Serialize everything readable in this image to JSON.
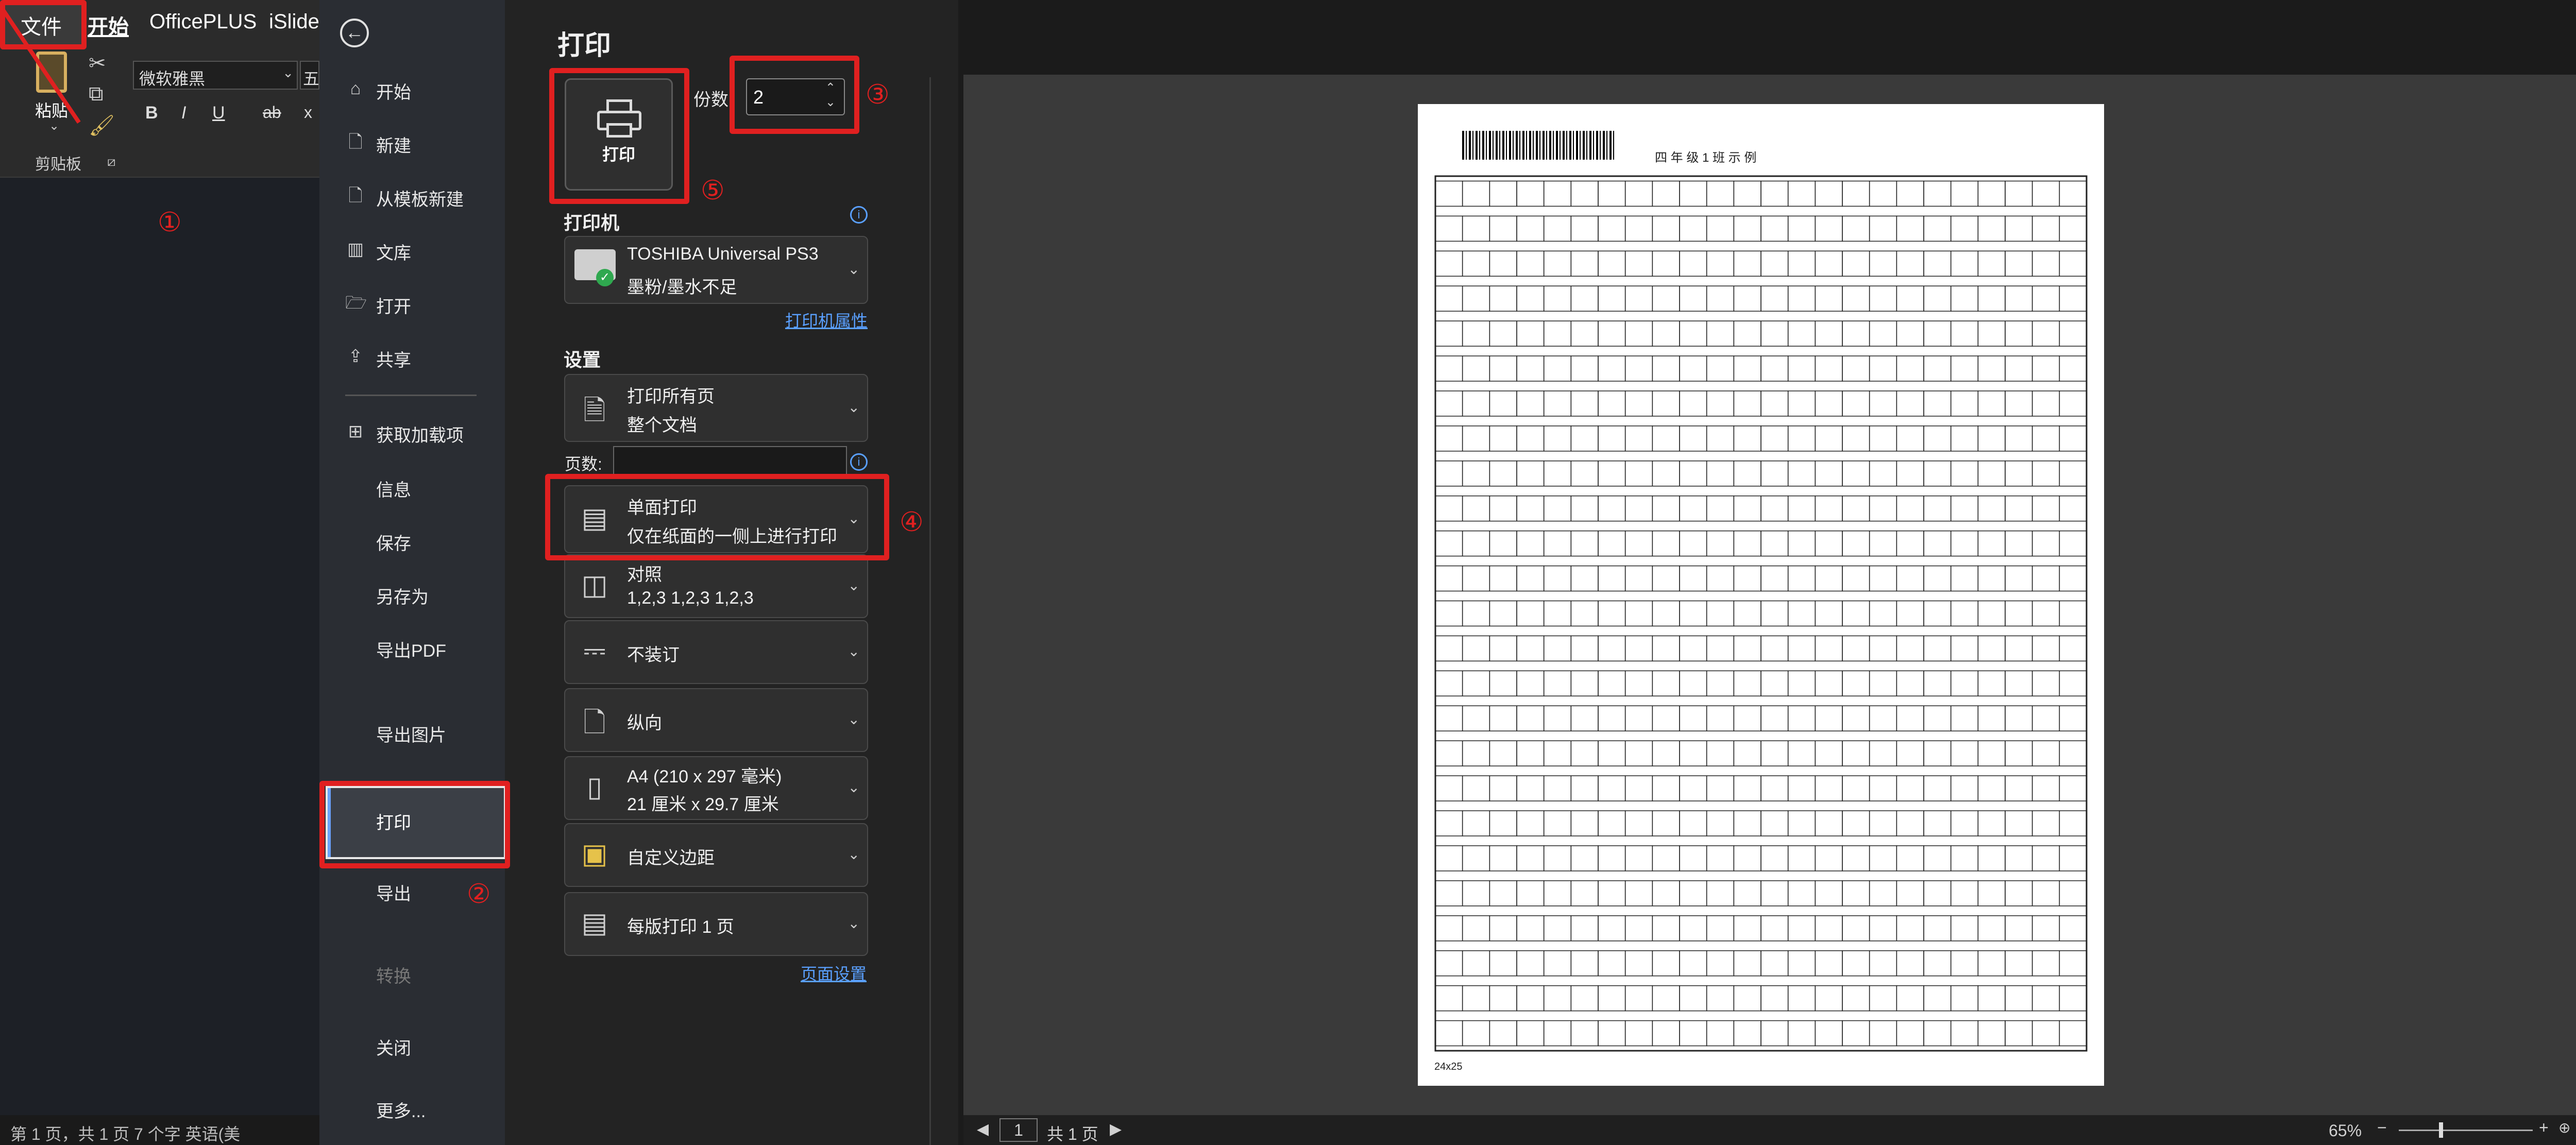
{
  "ribbon": {
    "tabs": [
      "文件",
      "开始",
      "OfficePLUS",
      "iSlide"
    ],
    "paste_label": "粘贴",
    "font_name": "微软雅黑",
    "font_size": "五",
    "clipboard_label": "剪贴板",
    "format_buttons": [
      "B",
      "I",
      "U",
      "ab",
      "x"
    ]
  },
  "status_left": "第 1 页，共 1 页    7 个字    英语(美",
  "nav": {
    "items": [
      "开始",
      "新建",
      "从模板新建",
      "文库",
      "打开",
      "共享",
      "获取加载项",
      "信息",
      "保存",
      "另存为",
      "导出PDF",
      "导出图片",
      "打印",
      "导出",
      "转换",
      "关闭",
      "更多..."
    ]
  },
  "print": {
    "title": "打印",
    "print_button": "打印",
    "copies_label": "份数",
    "copies_value": "2",
    "printer_heading": "打印机",
    "printer_name": "TOSHIBA Universal PS3",
    "printer_status": "墨粉/墨水不足",
    "printer_props_link": "打印机属性",
    "settings_heading": "设置",
    "pages_label": "页数:",
    "pages_value": "",
    "settings": [
      {
        "l1": "打印所有页",
        "l2": "整个文档",
        "icon": "document-icon"
      },
      {
        "l1": "单面打印",
        "l2": "仅在纸面的一侧上进行打印",
        "icon": "single-side-icon"
      },
      {
        "l1": "对照",
        "l2": "1,2,3    1,2,3    1,2,3",
        "icon": "collate-icon"
      },
      {
        "l1": "不装订",
        "l2": "",
        "icon": "staple-icon"
      },
      {
        "l1": "纵向",
        "l2": "",
        "icon": "portrait-icon"
      },
      {
        "l1": "A4 (210 x 297 毫米)",
        "l2": "21 厘米 x 29.7 厘米",
        "icon": "paper-size-icon"
      },
      {
        "l1": "自定义边距",
        "l2": "",
        "icon": "margins-icon"
      },
      {
        "l1": "每版打印 1 页",
        "l2": "",
        "icon": "pages-per-sheet-icon"
      }
    ],
    "page_setup_link": "页面设置"
  },
  "annotations": [
    "①",
    "②",
    "③",
    "④",
    "⑤"
  ],
  "paper": {
    "header_text": "四 年 级     1 班      示 例",
    "footer_text": "24x25"
  },
  "bottombar": {
    "page_input": "1",
    "page_total": "共 1 页",
    "zoom": "65%"
  },
  "colors": {
    "annotation": "#e02020",
    "link": "#5aa0ff",
    "panel": "#232323",
    "preview": "#3a3a3a"
  }
}
